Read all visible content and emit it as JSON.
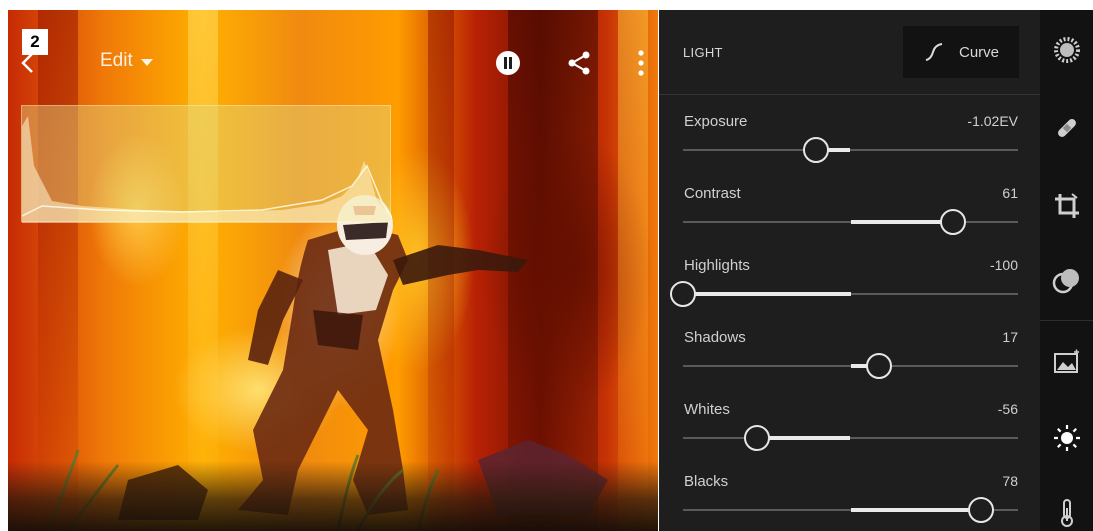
{
  "step_badge": "2",
  "topbar": {
    "edit_label": "Edit"
  },
  "panel": {
    "section_title": "LIGHT",
    "curve_label": "Curve",
    "sliders": [
      {
        "label": "Exposure",
        "value": "-1.02EV",
        "min": -5,
        "max": 5,
        "num": -1.02
      },
      {
        "label": "Contrast",
        "value": "61",
        "min": -100,
        "max": 100,
        "num": 61
      },
      {
        "label": "Highlights",
        "value": "-100",
        "min": -100,
        "max": 100,
        "num": -100
      },
      {
        "label": "Shadows",
        "value": "17",
        "min": -100,
        "max": 100,
        "num": 17
      },
      {
        "label": "Whites",
        "value": "-56",
        "min": -100,
        "max": 100,
        "num": -56
      },
      {
        "label": "Blacks",
        "value": "78",
        "min": -100,
        "max": 100,
        "num": 78
      }
    ]
  },
  "tools": [
    {
      "name": "presets-icon"
    },
    {
      "name": "healing-brush-icon"
    },
    {
      "name": "crop-icon"
    },
    {
      "name": "selective-icon"
    },
    {
      "name": "auto-icon"
    },
    {
      "name": "light-icon"
    },
    {
      "name": "color-temperature-icon"
    }
  ],
  "colors": {
    "panel_bg": "#1e1e1e",
    "tools_bg": "#121212",
    "slider_fill": "#eaeaea",
    "slider_track": "#5a5a5a"
  }
}
